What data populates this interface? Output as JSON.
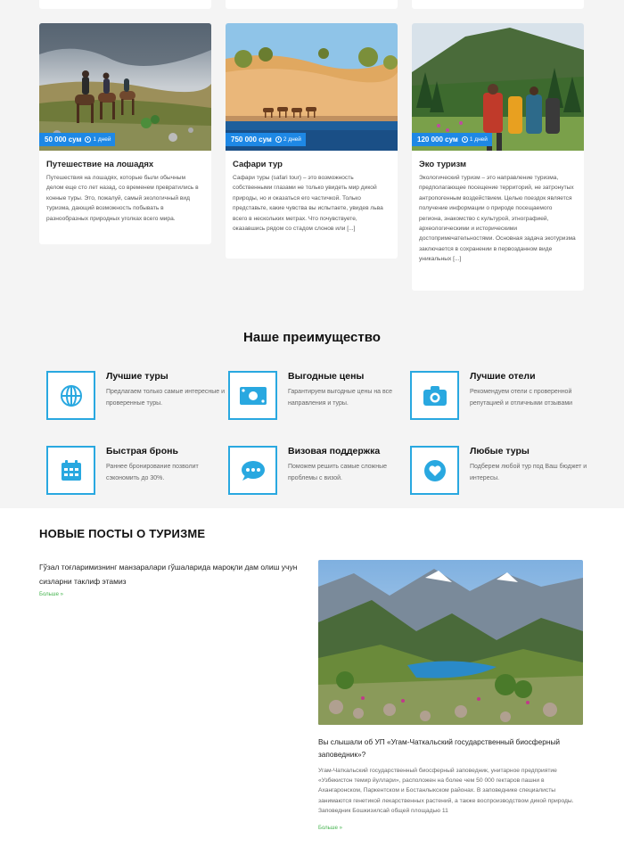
{
  "tours": [
    {
      "title": "Путешествие на лошадях",
      "price": "50 000 сум",
      "days": "1 дней",
      "description": "Путешествия на лошадях, которые были обычным делом еще сто лет назад, со временем превратились в конные туры. Это, пожалуй, самый экологичный вид туризма, дающий возможность побывать в разнообразных природных уголках всего мира."
    },
    {
      "title": "Сафари тур",
      "price": "750 000 сум",
      "days": "2 дней",
      "description": "Сафари туры (safari tour) – это возможность собственными глазами не только увидеть мир дикой природы, но и оказаться его частичкой. Только представьте, какие чувства вы испытаете, увидев льва всего в нескольких метрах. Что почувствуете, оказавшись рядом со стадом слонов или [...]"
    },
    {
      "title": "Эко туризм",
      "price": "120 000 сум",
      "days": "1 дней",
      "description": "Экологический туризм – это направление туризма, предполагающее посещение территорий, не затронутых антропогенным воздействием. Целью поездок является получение информации о природе посещаемого региона, знакомство с культурой, этнографией, археологическими и историческими достопримечательностями. Основная задача экотуризма заключается в сохранении в первозданном виде уникальных [...]"
    }
  ],
  "advantages": {
    "title": "Наше преимущество",
    "items": [
      {
        "name": "Лучшие туры",
        "desc": "Предлагаем только самые интересные и проверенные туры.",
        "icon": "globe-icon"
      },
      {
        "name": "Выгодные цены",
        "desc": "Гарантируем выгодные цены на все направления и туры.",
        "icon": "money-icon"
      },
      {
        "name": "Лучшие отели",
        "desc": "Рекомендуем отели с проверенной репутацией и отличными отзывами",
        "icon": "camera-icon"
      },
      {
        "name": "Быстрая бронь",
        "desc": "Раннее бронирование позволит сэкономить до 30%.",
        "icon": "calendar-icon"
      },
      {
        "name": "Визовая поддержка",
        "desc": "Поможем решить самые сложные проблемы с визой.",
        "icon": "chat-icon"
      },
      {
        "name": "Любые туры",
        "desc": "Подберем любой тур под Ваш бюджет и интересы.",
        "icon": "heart-icon"
      }
    ]
  },
  "posts": {
    "title": "НОВЫЕ ПОСТЫ О ТУРИЗМЕ",
    "small_post": {
      "title": "Гўзал тоғларимизнинг манзаралари гўшаларида мароқли дам олиш учун сизларни таклиф этамиз",
      "more": "Больше »"
    },
    "big_post": {
      "title": "Вы слышали об УП «Угам-Чаткальский государственный биосферный заповедник»?",
      "description": "Угам-Чаткальский государственный биосферный заповедник, унитарное предприятие «Узбекистон темир йуллари», расположен на более чем 50 000 гектаров пашни в Ахангаронском, Паркентском и Бостанлыкском районах. В заповеднике специалисты занимаются генетикой лекарственных растений, а также воспроизводством дикой природы. Заповедник Бошкизилсай общей площадью 11",
      "more": "Больше »"
    }
  },
  "colors": {
    "accent": "#29a8e0",
    "badge": "#1e88e5",
    "link": "#46b450"
  }
}
